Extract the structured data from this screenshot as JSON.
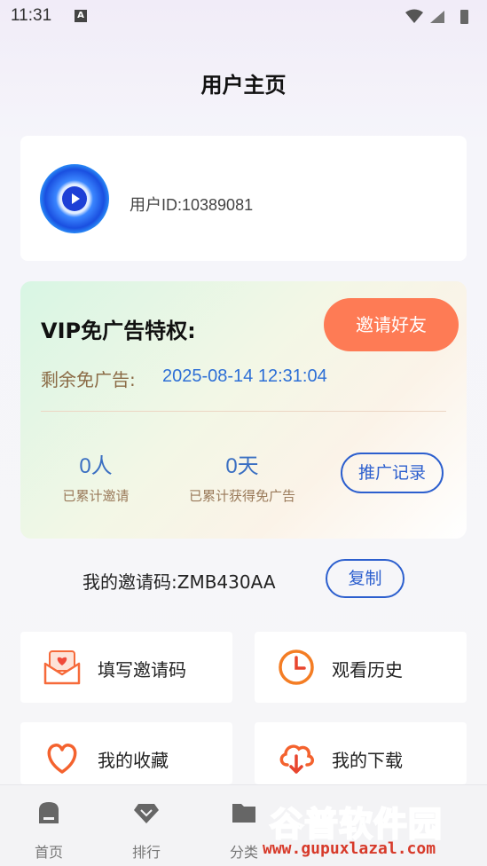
{
  "status_bar": {
    "time": "11:31",
    "notif_letter": "A"
  },
  "page": {
    "title": "用户主页"
  },
  "user": {
    "id_text": "用户ID:10389081"
  },
  "vip": {
    "title": "VIP免广告特权:",
    "invite_button": "邀请好友",
    "remain_label": "剩余免广告:",
    "remain_value": "2025-08-14 12:31:04",
    "stats": [
      {
        "value": "0人",
        "label": "已累计邀请"
      },
      {
        "value": "0天",
        "label": "已累计获得免广告"
      }
    ],
    "record_button": "推广记录"
  },
  "invite_code": {
    "text": "我的邀请码:ZMB430AA",
    "copy_button": "复制"
  },
  "menu": [
    {
      "label": "填写邀请码",
      "icon": "envelope-heart-icon"
    },
    {
      "label": "观看历史",
      "icon": "clock-icon"
    },
    {
      "label": "我的收藏",
      "icon": "heart-icon"
    },
    {
      "label": "我的下载",
      "icon": "cloud-download-icon"
    }
  ],
  "bottom_nav": [
    {
      "label": "首页",
      "icon": "home-icon"
    },
    {
      "label": "排行",
      "icon": "diamond-icon"
    },
    {
      "label": "分类",
      "icon": "folder-icon"
    }
  ],
  "watermark": {
    "main": "谷普软件园",
    "url": "www.gupuxlazal.com"
  },
  "colors": {
    "accent_orange": "#fe7b55",
    "link_blue": "#2c5fce",
    "value_blue": "#2d6fd6"
  }
}
